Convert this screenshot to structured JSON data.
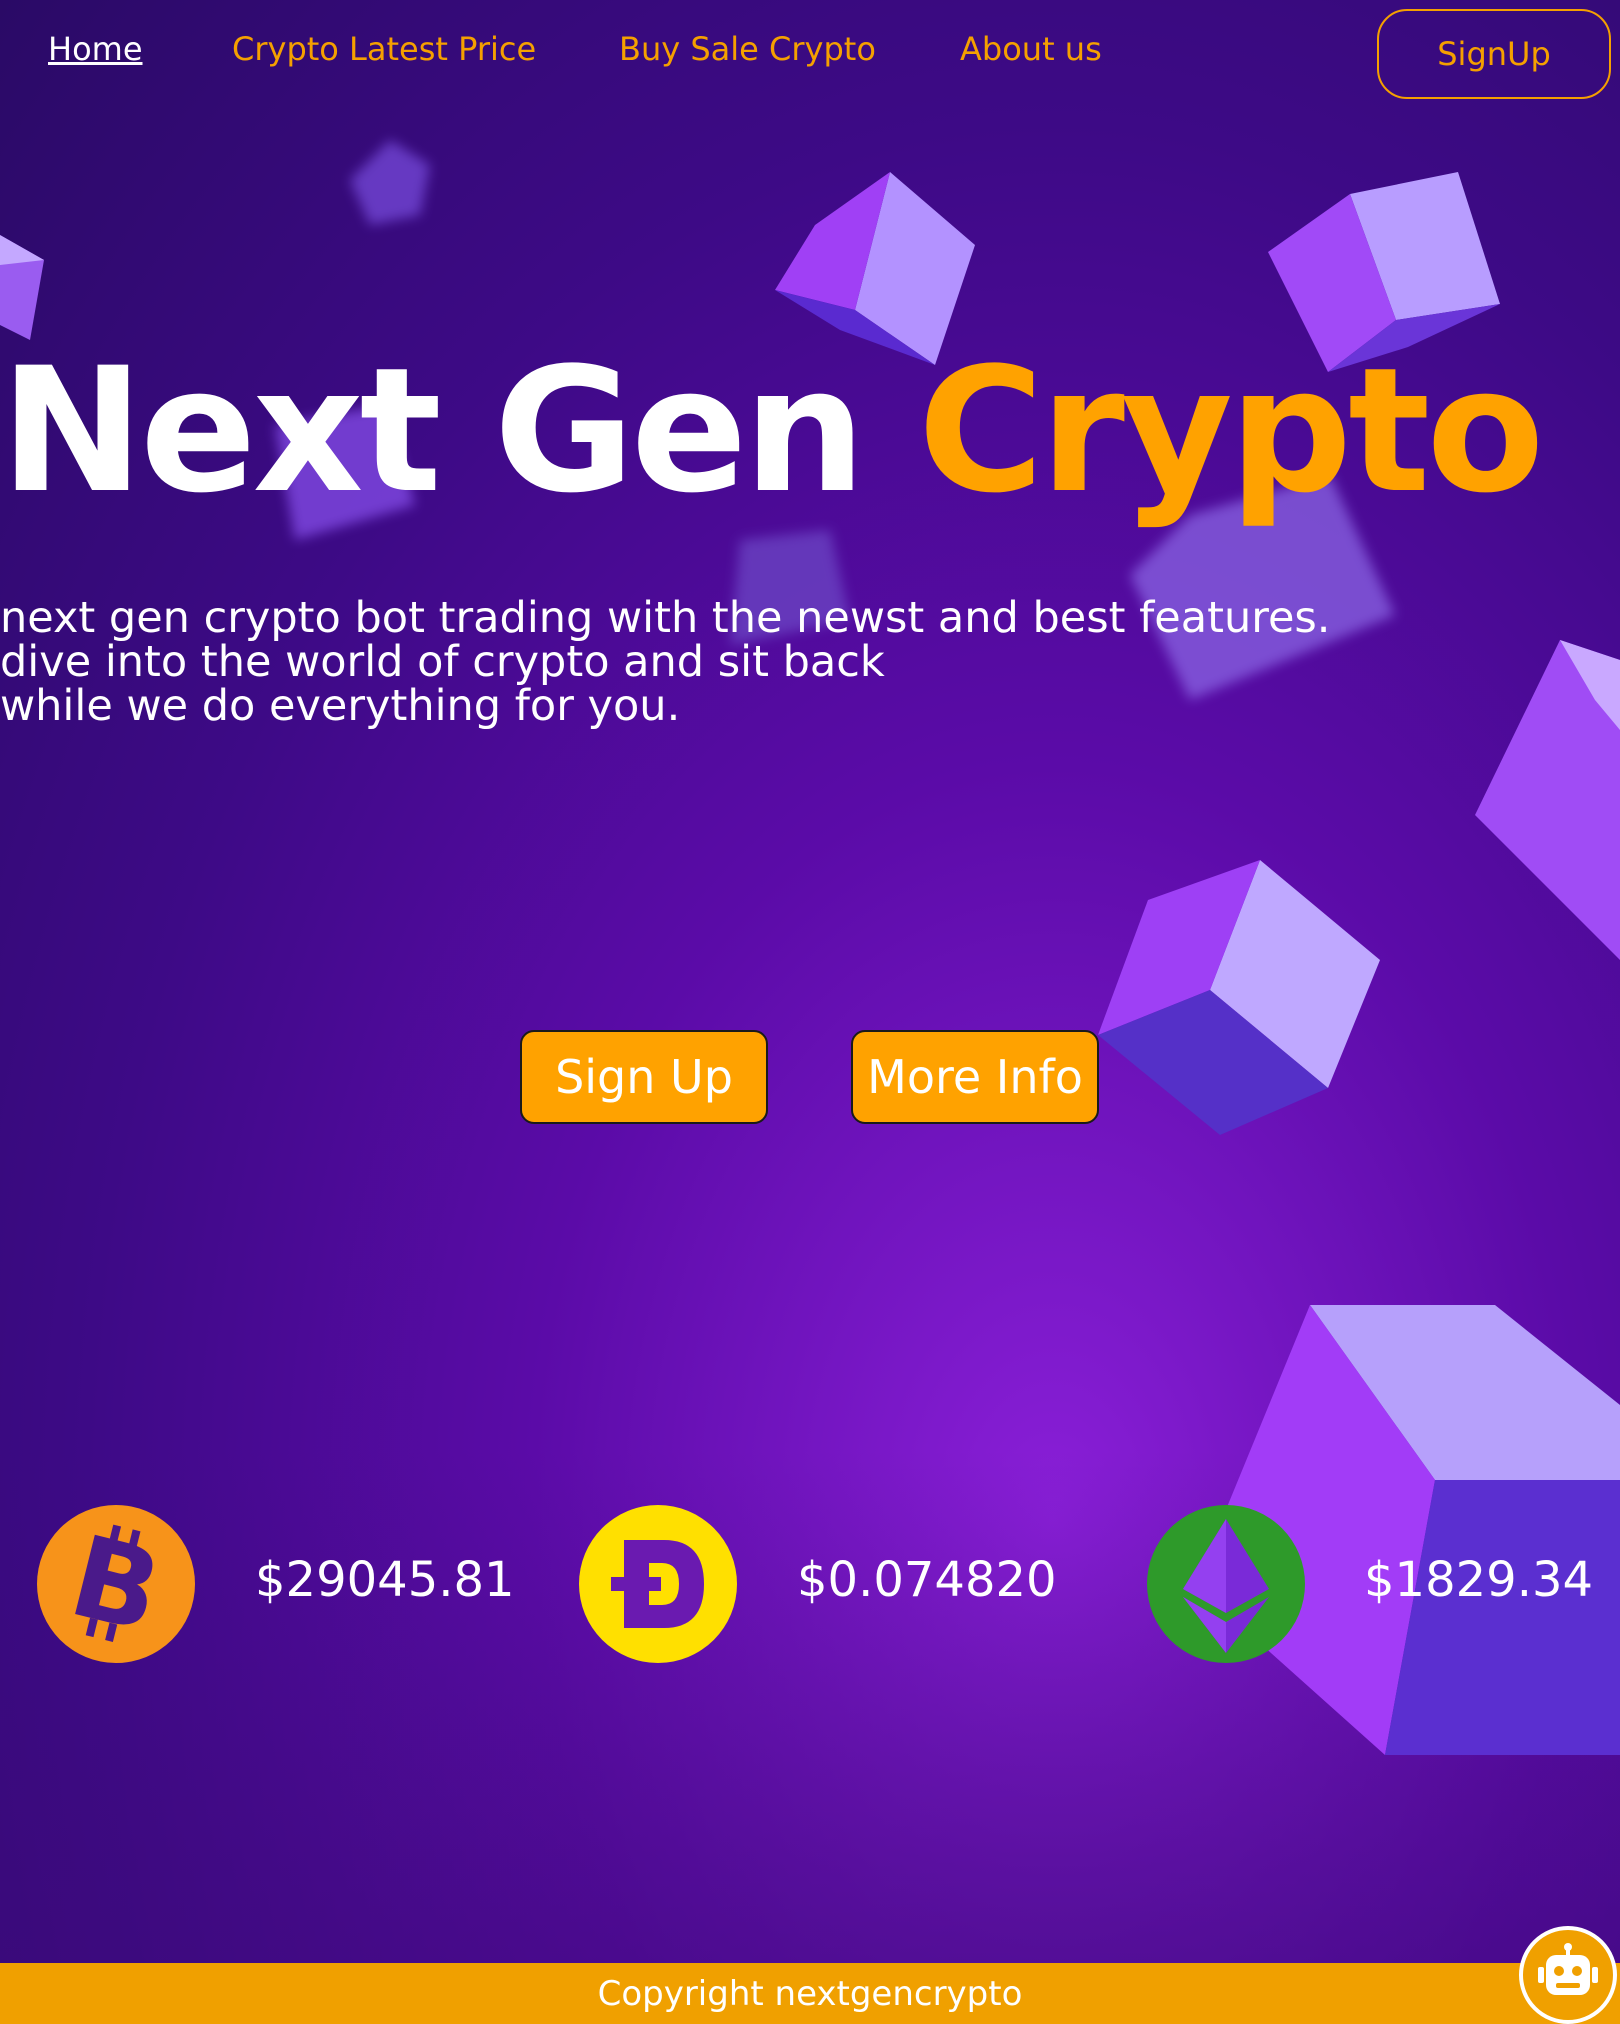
{
  "nav": {
    "links": [
      "Home",
      "Crypto Latest Price",
      "Buy Sale Crypto",
      "About us"
    ],
    "signup_label": "SignUp"
  },
  "hero": {
    "title_part1": "Next Gen",
    "title_part2": "Crypto",
    "description_lines": [
      "next gen crypto bot trading with the newst and best features.",
      "dive into the world of crypto and sit back",
      "while we do everything for you."
    ],
    "signup_button": "Sign Up",
    "more_info_button": "More Info"
  },
  "prices": [
    {
      "coin": "bitcoin-icon",
      "price": "$29045.81",
      "color": "#f7931a"
    },
    {
      "coin": "dogecoin-icon",
      "price": "$0.074820",
      "color": "#ffe000"
    },
    {
      "coin": "ethereum-icon",
      "price": "$1829.34",
      "color": "#2e9a2a"
    }
  ],
  "footer": {
    "copyright": "Copyright nextgencrypto"
  },
  "colors": {
    "accent": "#ffa200",
    "background": "#4a0a96"
  }
}
